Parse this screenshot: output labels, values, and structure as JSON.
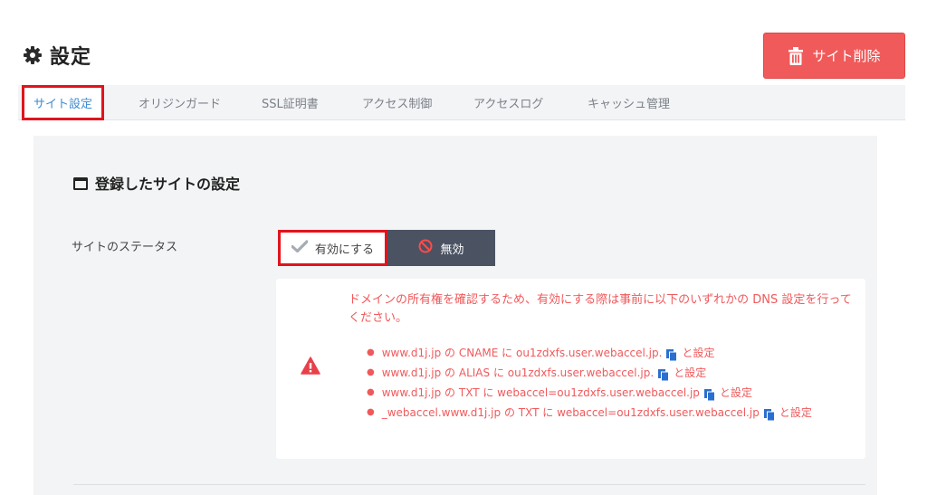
{
  "header": {
    "title": "設定",
    "delete_button_label": "サイト削除"
  },
  "tabs": [
    {
      "label": "サイト設定",
      "active": true
    },
    {
      "label": "オリジンガード",
      "active": false
    },
    {
      "label": "SSL証明書",
      "active": false
    },
    {
      "label": "アクセス制御",
      "active": false
    },
    {
      "label": "アクセスログ",
      "active": false
    },
    {
      "label": "キャッシュ管理",
      "active": false
    }
  ],
  "section": {
    "heading": "登録したサイトの設定",
    "status_label": "サイトのステータス",
    "enable_label": "有効にする",
    "disable_label": "無効"
  },
  "warning": {
    "message": "ドメインの所有権を確認するため、有効にする際は事前に以下のいずれかの DNS 設定を行ってください。",
    "items": [
      {
        "prefix": "www.d1j.jp の CNAME に ou1zdxfs.user.webaccel.jp.",
        "suffix": "と設定"
      },
      {
        "prefix": "www.d1j.jp の ALIAS に ou1zdxfs.user.webaccel.jp.",
        "suffix": "と設定"
      },
      {
        "prefix": "www.d1j.jp の TXT に webaccel=ou1zdxfs.user.webaccel.jp",
        "suffix": "と設定"
      },
      {
        "prefix": "_webaccel.www.d1j.jp の TXT に webaccel=ou1zdxfs.user.webaccel.jp",
        "suffix": "と設定"
      }
    ]
  },
  "colors": {
    "accent_blue": "#3f8bd1",
    "danger_red": "#f05a5a",
    "warning_text": "#f0595b",
    "highlight_red": "#e0141e",
    "dark_button": "#4b5363"
  },
  "icons": {
    "title": "gear-icon",
    "delete": "trash-icon",
    "section": "window-icon",
    "enable": "check-icon",
    "disable": "prohibited-icon",
    "warning": "warning-triangle-icon",
    "copy": "copy-icon"
  }
}
